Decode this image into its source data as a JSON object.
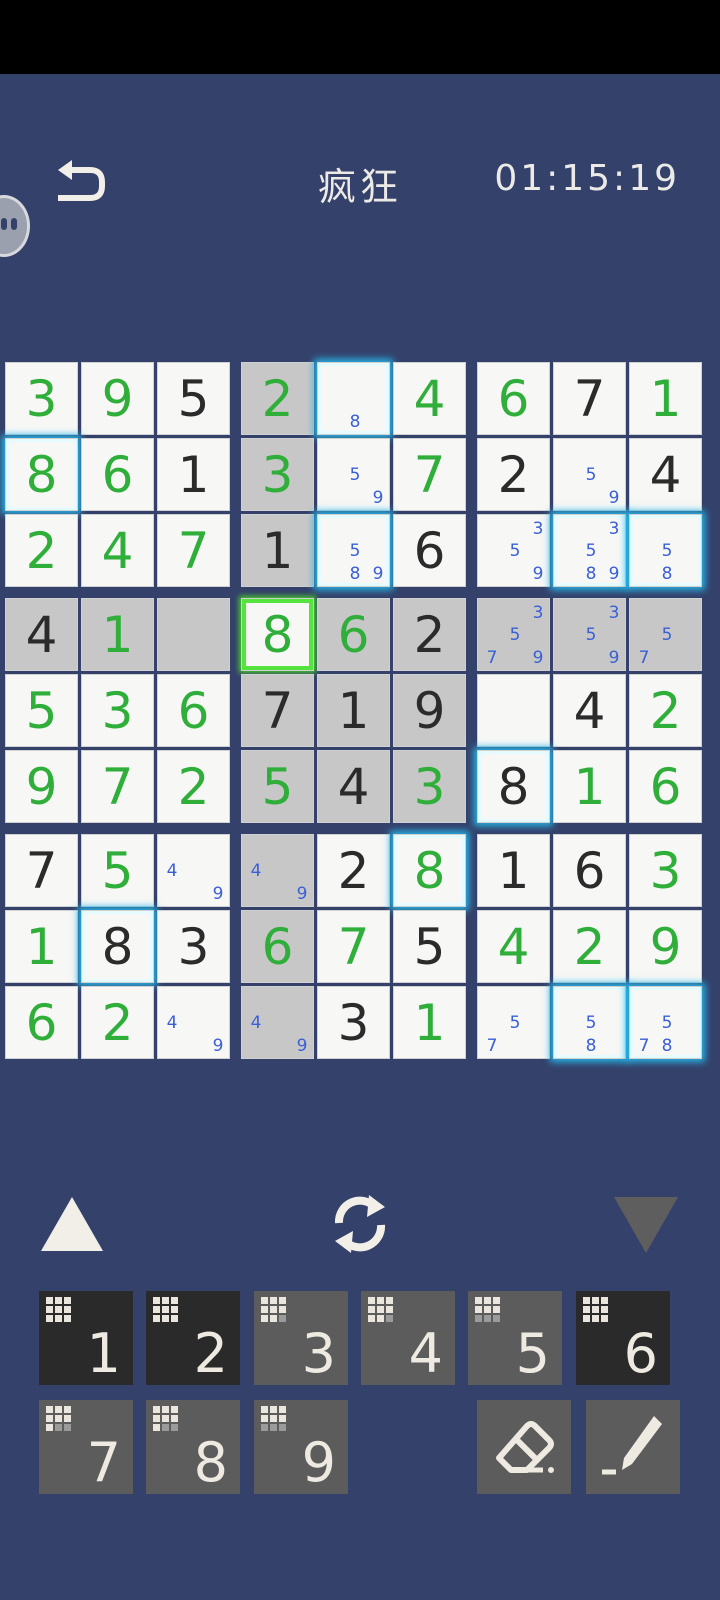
{
  "header": {
    "title": "疯狂",
    "timer": "01:15:19"
  },
  "colors": {
    "background": "#34416a",
    "user_digit": "#2fae3a",
    "given_digit": "#2b2b2b",
    "note": "#3a60d6",
    "select_glow": "#27b6e8",
    "focus_glow": "#55e33e"
  },
  "board": {
    "cells": [
      [
        {
          "v": "3",
          "t": "u"
        },
        {
          "v": "9",
          "t": "u"
        },
        {
          "v": "5",
          "t": "g"
        },
        {
          "v": "2",
          "t": "u",
          "shade": true
        },
        {
          "notes": [
            "8"
          ],
          "sel": true
        },
        {
          "v": "4",
          "t": "u"
        },
        {
          "v": "6",
          "t": "u"
        },
        {
          "v": "7",
          "t": "g"
        },
        {
          "v": "1",
          "t": "u"
        }
      ],
      [
        {
          "v": "8",
          "t": "u",
          "sel": true
        },
        {
          "v": "6",
          "t": "u"
        },
        {
          "v": "1",
          "t": "g"
        },
        {
          "v": "3",
          "t": "u",
          "shade": true
        },
        {
          "notes": [
            "5",
            "9"
          ]
        },
        {
          "v": "7",
          "t": "u"
        },
        {
          "v": "2",
          "t": "g"
        },
        {
          "notes": [
            "5",
            "9"
          ]
        },
        {
          "v": "4",
          "t": "g"
        }
      ],
      [
        {
          "v": "2",
          "t": "u"
        },
        {
          "v": "4",
          "t": "u"
        },
        {
          "v": "7",
          "t": "u"
        },
        {
          "v": "1",
          "t": "g",
          "shade": true
        },
        {
          "notes": [
            "5",
            "8",
            "9"
          ],
          "sel": true
        },
        {
          "v": "6",
          "t": "g"
        },
        {
          "notes": [
            "3",
            "5",
            "9"
          ]
        },
        {
          "notes": [
            "3",
            "5",
            "8",
            "9"
          ],
          "sel": true
        },
        {
          "notes": [
            "5",
            "8"
          ],
          "sel": true
        }
      ],
      [
        {
          "v": "4",
          "t": "g",
          "shade": true
        },
        {
          "v": "1",
          "t": "u",
          "shade": true
        },
        {
          "shade": true
        },
        {
          "v": "8",
          "t": "u",
          "focus": true
        },
        {
          "v": "6",
          "t": "u",
          "shade": true
        },
        {
          "v": "2",
          "t": "g",
          "shade": true
        },
        {
          "notes": [
            "3",
            "5",
            "7",
            "9"
          ],
          "shade": true
        },
        {
          "notes": [
            "3",
            "5",
            "9"
          ],
          "shade": true
        },
        {
          "notes": [
            "5",
            "7"
          ],
          "shade": true
        }
      ],
      [
        {
          "v": "5",
          "t": "u"
        },
        {
          "v": "3",
          "t": "u"
        },
        {
          "v": "6",
          "t": "u"
        },
        {
          "v": "7",
          "t": "g",
          "shade": true
        },
        {
          "v": "1",
          "t": "g",
          "shade": true
        },
        {
          "v": "9",
          "t": "g",
          "shade": true
        },
        {},
        {
          "v": "4",
          "t": "g"
        },
        {
          "v": "2",
          "t": "u"
        }
      ],
      [
        {
          "v": "9",
          "t": "u"
        },
        {
          "v": "7",
          "t": "u"
        },
        {
          "v": "2",
          "t": "u"
        },
        {
          "v": "5",
          "t": "u",
          "shade": true
        },
        {
          "v": "4",
          "t": "g",
          "shade": true
        },
        {
          "v": "3",
          "t": "u",
          "shade": true
        },
        {
          "v": "8",
          "t": "g",
          "sel": true
        },
        {
          "v": "1",
          "t": "u"
        },
        {
          "v": "6",
          "t": "u"
        }
      ],
      [
        {
          "v": "7",
          "t": "g"
        },
        {
          "v": "5",
          "t": "u"
        },
        {
          "notes": [
            "4",
            "9"
          ]
        },
        {
          "notes": [
            "4",
            "9"
          ],
          "shade": true
        },
        {
          "v": "2",
          "t": "g"
        },
        {
          "v": "8",
          "t": "u",
          "sel": true
        },
        {
          "v": "1",
          "t": "g"
        },
        {
          "v": "6",
          "t": "g"
        },
        {
          "v": "3",
          "t": "u"
        }
      ],
      [
        {
          "v": "1",
          "t": "u"
        },
        {
          "v": "8",
          "t": "g",
          "sel": true
        },
        {
          "v": "3",
          "t": "g"
        },
        {
          "v": "6",
          "t": "u",
          "shade": true
        },
        {
          "v": "7",
          "t": "u"
        },
        {
          "v": "5",
          "t": "g"
        },
        {
          "v": "4",
          "t": "u"
        },
        {
          "v": "2",
          "t": "u"
        },
        {
          "v": "9",
          "t": "u"
        }
      ],
      [
        {
          "v": "6",
          "t": "u"
        },
        {
          "v": "2",
          "t": "u"
        },
        {
          "notes": [
            "4",
            "9"
          ]
        },
        {
          "notes": [
            "4",
            "9"
          ],
          "shade": true
        },
        {
          "v": "3",
          "t": "g"
        },
        {
          "v": "1",
          "t": "u"
        },
        {
          "notes": [
            "5",
            "7"
          ]
        },
        {
          "notes": [
            "5",
            "8"
          ],
          "sel": true
        },
        {
          "notes": [
            "5",
            "7",
            "8"
          ],
          "sel": true
        }
      ]
    ]
  },
  "controls": {
    "up": "arrow-up-icon",
    "refresh": "refresh-icon",
    "down": "arrow-down-icon"
  },
  "numpad": [
    {
      "label": "1",
      "dark": true,
      "remaining": 0
    },
    {
      "label": "2",
      "dark": true,
      "remaining": 0
    },
    {
      "label": "3",
      "dark": false,
      "remaining": 1
    },
    {
      "label": "4",
      "dark": false,
      "remaining": 1
    },
    {
      "label": "5",
      "dark": false,
      "remaining": 3
    },
    {
      "label": "6",
      "dark": true,
      "remaining": 0
    },
    {
      "label": "7",
      "dark": false,
      "remaining": 2
    },
    {
      "label": "8",
      "dark": false,
      "remaining": 2
    },
    {
      "label": "9",
      "dark": false,
      "remaining": 3
    }
  ],
  "tools": {
    "erase": "eraser-icon",
    "pencil": "pencil-icon"
  }
}
